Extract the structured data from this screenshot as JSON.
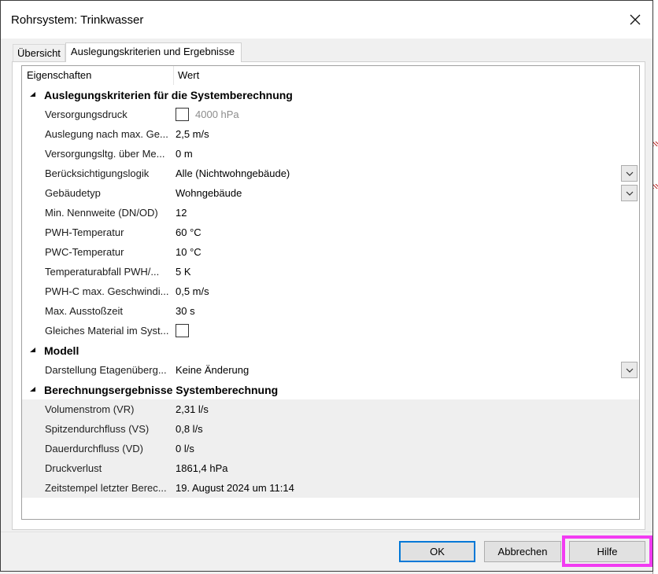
{
  "window": {
    "title": "Rohrsystem: Trinkwasser"
  },
  "tabs": [
    {
      "label": "Übersicht",
      "active": false
    },
    {
      "label": "Auslegungskriterien und Ergebnisse",
      "active": true
    }
  ],
  "grid": {
    "header": {
      "col1": "Eigenschaften",
      "col2": "Wert"
    },
    "groups": [
      {
        "title": "Auslegungskriterien für die Systemberechnung",
        "rows": [
          {
            "label": "Versorgungsdruck",
            "value": "4000 hPa",
            "checkbox": true
          },
          {
            "label": "Auslegung nach max. Ge...",
            "value": "2,5 m/s"
          },
          {
            "label": "Versorgungsltg. über Me...",
            "value": "0 m"
          },
          {
            "label": "Berücksichtigungslogik",
            "value": "Alle (Nichtwohngebäude)",
            "dropdown": true
          },
          {
            "label": "Gebäudetyp",
            "value": "Wohngebäude",
            "dropdown": true
          },
          {
            "label": "Min. Nennweite (DN/OD)",
            "value": "12"
          },
          {
            "label": "PWH-Temperatur",
            "value": "60 °C"
          },
          {
            "label": "PWC-Temperatur",
            "value": "10 °C"
          },
          {
            "label": "Temperaturabfall PWH/...",
            "value": "5 K"
          },
          {
            "label": "PWH-C max. Geschwindi...",
            "value": "0,5 m/s"
          },
          {
            "label": "Max. Ausstoßzeit",
            "value": "30 s"
          },
          {
            "label": "Gleiches Material im Syst...",
            "value": "",
            "checkbox": true
          }
        ]
      },
      {
        "title": "Modell",
        "rows": [
          {
            "label": "Darstellung Etagenüberg...",
            "value": "Keine Änderung",
            "dropdown": true
          }
        ]
      },
      {
        "title": "Berechnungsergebnisse Systemberechnung",
        "rows": [
          {
            "label": "Volumenstrom (VR)",
            "value": "2,31 l/s"
          },
          {
            "label": "Spitzendurchfluss (VS)",
            "value": "0,8 l/s"
          },
          {
            "label": "Dauerdurchfluss (VD)",
            "value": "0 l/s"
          },
          {
            "label": "Druckverlust",
            "value": "1861,4 hPa"
          },
          {
            "label": "Zeitstempel letzter Berec...",
            "value": "19. August 2024 um 11:14"
          }
        ]
      }
    ]
  },
  "buttons": {
    "ok": "OK",
    "cancel": "Abbrechen",
    "help": "Hilfe"
  },
  "colors": {
    "accent": "#0078d7",
    "highlight": "#f23bf2",
    "result_bg": "#efefef"
  },
  "icons": {
    "close": "close-icon",
    "collapse": "collapse-triangle-icon",
    "dropdown": "chevron-down-icon"
  }
}
